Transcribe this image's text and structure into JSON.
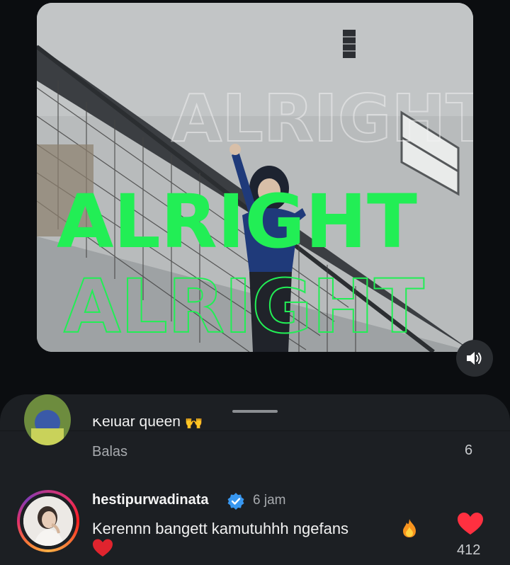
{
  "video": {
    "overlay_text_outline_top": "ALRIGHT",
    "overlay_text_main": "ALRIGHT",
    "overlay_text_outline_bottom": "ALRIGHT",
    "overlay_color": "#22ee55",
    "sound_icon": "speaker-on-icon"
  },
  "comments": {
    "previous": {
      "text_partial": "Keluar queen 🙌",
      "reply_label": "Balas",
      "like_count": "6"
    },
    "current": {
      "username": "hestipurwadinata",
      "verified_icon": "verified-badge-icon",
      "time": "6 jam",
      "text": "Kerennn bangett kamutuhhh ngefans",
      "like_count": "412",
      "like_color": "#ff3040"
    },
    "reply_label": "Balas"
  }
}
